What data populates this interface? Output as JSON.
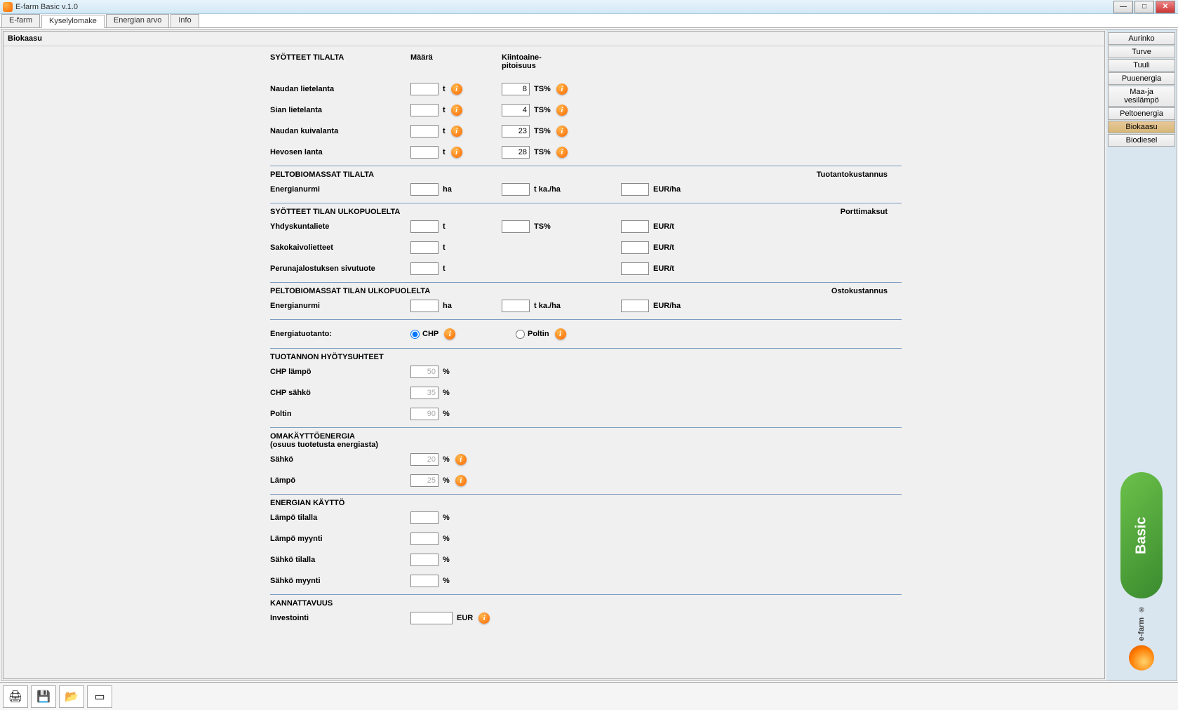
{
  "window_title": "E-farm Basic v.1.0",
  "tabs": [
    "E-farm",
    "Kyselylomake",
    "Energian arvo",
    "Info"
  ],
  "active_tab": 1,
  "page_title": "Biokaasu",
  "headers": {
    "syotteet": "SYÖTTEET TILALTA",
    "maara": "Määrä",
    "kiintoaine": "Kiintoaine-\npitoisuus"
  },
  "inputs_farm": [
    {
      "label": "Naudan lietelanta",
      "v1": "",
      "u1": "t",
      "v2": "8",
      "u2": "TS%"
    },
    {
      "label": "Sian lietelanta",
      "v1": "",
      "u1": "t",
      "v2": "4",
      "u2": "TS%"
    },
    {
      "label": "Naudan kuivalanta",
      "v1": "",
      "u1": "t",
      "v2": "23",
      "u2": "TS%"
    },
    {
      "label": "Hevosen lanta",
      "v1": "",
      "u1": "t",
      "v2": "28",
      "u2": "TS%"
    }
  ],
  "biomass_farm": {
    "title": "PELTOBIOMASSAT TILALTA",
    "right": "Tuotantokustannus",
    "row": {
      "label": "Energianurmi",
      "u1": "ha",
      "u2": "t ka./ha",
      "u3": "EUR/ha"
    }
  },
  "inputs_external": {
    "title": "SYÖTTEET TILAN ULKOPUOLELTA",
    "right": "Porttimaksut",
    "rows": [
      {
        "label": "Yhdyskuntaliete",
        "u1": "t",
        "u2": "TS%",
        "u3": "EUR/t"
      },
      {
        "label": "Sakokaivolietteet",
        "u1": "t",
        "u2": "",
        "u3": "EUR/t"
      },
      {
        "label": "Perunajalostuksen sivutuote",
        "u1": "t",
        "u2": "",
        "u3": "EUR/t"
      }
    ]
  },
  "biomass_external": {
    "title": "PELTOBIOMASSAT TILAN ULKOPUOLELTA",
    "right": "Ostokustannus",
    "row": {
      "label": "Energianurmi",
      "u1": "ha",
      "u2": "t ka./ha",
      "u3": "EUR/ha"
    }
  },
  "energy_prod": {
    "label": "Energiatuotanto:",
    "opt1": "CHP",
    "opt2": "Poltin"
  },
  "efficiency": {
    "title": "TUOTANNON HYÖTYSUHTEET",
    "rows": [
      {
        "label": "CHP lämpö",
        "v": "50",
        "u": "%"
      },
      {
        "label": "CHP sähkö",
        "v": "35",
        "u": "%"
      },
      {
        "label": "Poltin",
        "v": "90",
        "u": "%"
      }
    ]
  },
  "own_use": {
    "title": "OMAKÄYTTÖENERGIA",
    "sub": "(osuus tuotetusta energiasta)",
    "rows": [
      {
        "label": "Sähkö",
        "v": "20",
        "u": "%"
      },
      {
        "label": "Lämpö",
        "v": "25",
        "u": "%"
      }
    ]
  },
  "energy_use": {
    "title": "ENERGIAN KÄYTTÖ",
    "rows": [
      {
        "label": "Lämpö tilalla",
        "u": "%"
      },
      {
        "label": "Lämpö myynti",
        "u": "%"
      },
      {
        "label": "Sähkö tilalla",
        "u": "%"
      },
      {
        "label": "Sähkö myynti",
        "u": "%"
      }
    ]
  },
  "profitability": {
    "title": "KANNATTAVUUS",
    "rows": [
      {
        "label": "Investointi",
        "u": "EUR"
      }
    ]
  },
  "sidebar": {
    "items": [
      "Aurinko",
      "Turve",
      "Tuuli",
      "Puuenergia",
      "Maa-ja vesilämpö",
      "Peltoenergia",
      "Biokaasu",
      "Biodiesel"
    ],
    "active": 6,
    "logo_basic": "Basic",
    "logo_efarm": "e-farm"
  },
  "bottom_icons": [
    "print-icon",
    "save-icon",
    "open-icon",
    "battery-icon"
  ],
  "info_glyph": "i"
}
